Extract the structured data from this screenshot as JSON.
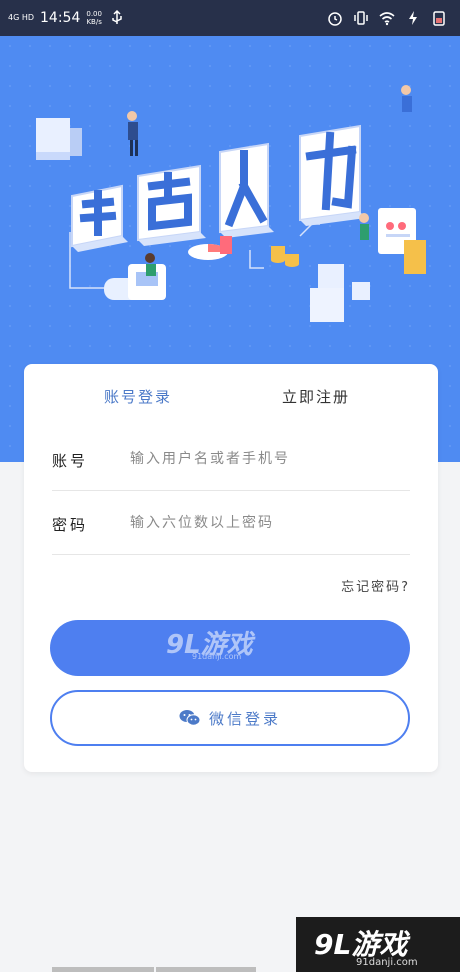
{
  "status_bar": {
    "signal": "4G HD",
    "time": "14:54",
    "net_speed_value": "0.00",
    "net_speed_unit": "KB/s",
    "icons": [
      "signal-icon",
      "usb-icon",
      "alarm-icon",
      "vibrate-icon",
      "wifi-icon",
      "charging-icon",
      "battery-icon"
    ]
  },
  "hero": {
    "title_art": "起点人力"
  },
  "tabs": {
    "login": "账号登录",
    "register": "立即注册"
  },
  "form": {
    "account_label": "账号",
    "account_placeholder": "输入用户名或者手机号",
    "password_label": "密码",
    "password_placeholder": "输入六位数以上密码",
    "forgot": "忘记密码?"
  },
  "buttons": {
    "wechat_login": "微信登录"
  },
  "watermark": {
    "logo": "9L游戏",
    "url": "91danji.com"
  },
  "colors": {
    "accent": "#4e7ff0",
    "hero_bg": "#4f8bf2",
    "status_bar": "#27304a",
    "tab_active": "#4c7ac8"
  }
}
